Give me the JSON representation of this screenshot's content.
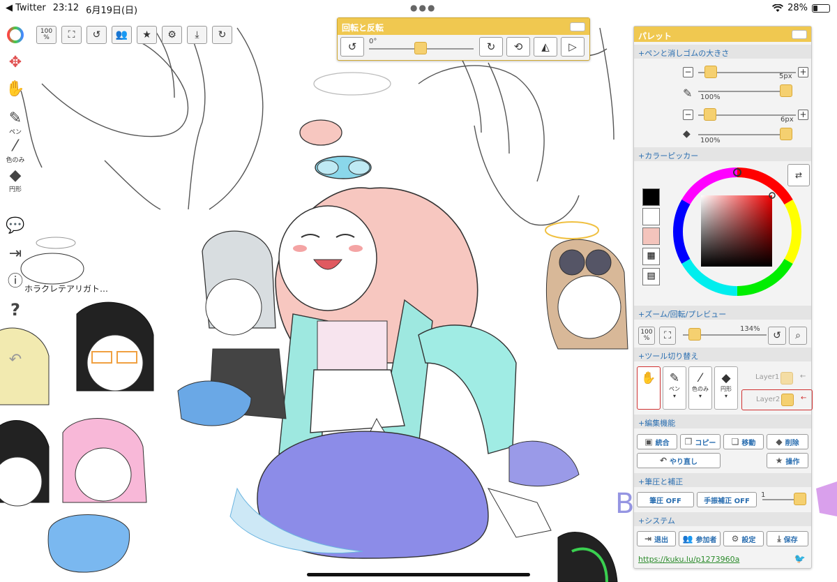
{
  "status_bar": {
    "back_app": "◀ Twitter",
    "time": "23:12",
    "date": "6月19日(日)",
    "battery_text": "28%",
    "battery_level": 0.28
  },
  "left_tools": [
    {
      "name": "color-wheel-icon",
      "label": ""
    },
    {
      "name": "move-icon",
      "label": ""
    },
    {
      "name": "hand-icon",
      "label": ""
    },
    {
      "name": "pen-icon",
      "label": "ペン"
    },
    {
      "name": "eyedropper-icon",
      "label": "色のみ"
    },
    {
      "name": "eraser-icon",
      "label": "円形"
    },
    {
      "name": "chat-icon",
      "label": ""
    },
    {
      "name": "exit-icon",
      "label": ""
    },
    {
      "name": "info-icon",
      "label": ""
    },
    {
      "name": "help-icon",
      "label": "?"
    },
    {
      "name": "undo-icon",
      "label": ""
    }
  ],
  "top_toolbar": {
    "zoom_label": "100",
    "zoom_unit": "%",
    "buttons": [
      "fit-screen-icon",
      "rotate-icon",
      "participants-icon",
      "star-icon",
      "gear-icon",
      "download-icon",
      "redo-icon"
    ]
  },
  "rotate_window": {
    "title": "回転と反転",
    "angle_label": "0°",
    "angle_value": 0
  },
  "palette": {
    "title": "パレット",
    "pen_size_section": "+ペンと消しゴムの大きさ",
    "pen_size": "5px",
    "pen_opacity": "100%",
    "eraser_size": "6px",
    "eraser_opacity": "100%",
    "color_picker_section": "+カラーピッカー",
    "swatches": [
      "#000000",
      "#ffffff",
      "#f4c4bc"
    ],
    "zoom_section": "+ズーム/回転/プレビュー",
    "zoom_btn": "100",
    "zoom_btn_unit": "%",
    "zoom_value": "134%",
    "tool_switch_section": "+ツール切り替え",
    "tools": [
      {
        "label": ""
      },
      {
        "label": "ペン"
      },
      {
        "label": "色のみ"
      },
      {
        "label": "円形"
      }
    ],
    "layers": [
      "Layer1",
      "Layer2"
    ],
    "edit_section": "+編集機能",
    "edit_buttons": {
      "merge": "統合",
      "copy": "コピー",
      "move": "移動",
      "delete": "削除",
      "redo": "やり直し",
      "operate": "操作"
    },
    "pressure_section": "+筆圧と補正",
    "pressure_btn": "筆圧 OFF",
    "stabilizer_btn": "手振補正 OFF",
    "stabilizer_value": "1",
    "system_section": "+システム",
    "system_buttons": {
      "exit": "退出",
      "participants": "参加者",
      "settings": "設定",
      "save": "保存"
    },
    "url": "https://kuku.lu/p1273960a"
  },
  "canvas_text": {
    "speech": "ホラクレテアリガト…"
  }
}
